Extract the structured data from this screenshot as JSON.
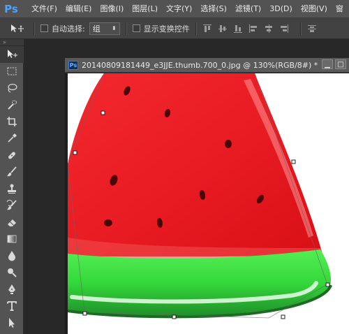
{
  "app": {
    "logo": "Ps",
    "menu": [
      "文件(F)",
      "编辑(E)",
      "图像(I)",
      "图层(L)",
      "文字(Y)",
      "选择(S)",
      "滤镜(T)",
      "3D(D)",
      "视图(V)",
      "窗"
    ]
  },
  "options": {
    "auto_select_label": "自动选择:",
    "auto_select_value": "组",
    "show_transform_label": "显示变换控件"
  },
  "tools_panel": {
    "collapse_glyph": "»"
  },
  "document": {
    "title": "20140809181449_e3JJE.thumb.700_0.jpg @ 130%(RGB/8#) *",
    "ps_badge": "Ps",
    "minimize_glyph": "▁",
    "maximize_glyph": "□"
  },
  "colors": {
    "flesh": "#ea1c24",
    "rind": "#3cd640",
    "seed": "#4a0608"
  }
}
